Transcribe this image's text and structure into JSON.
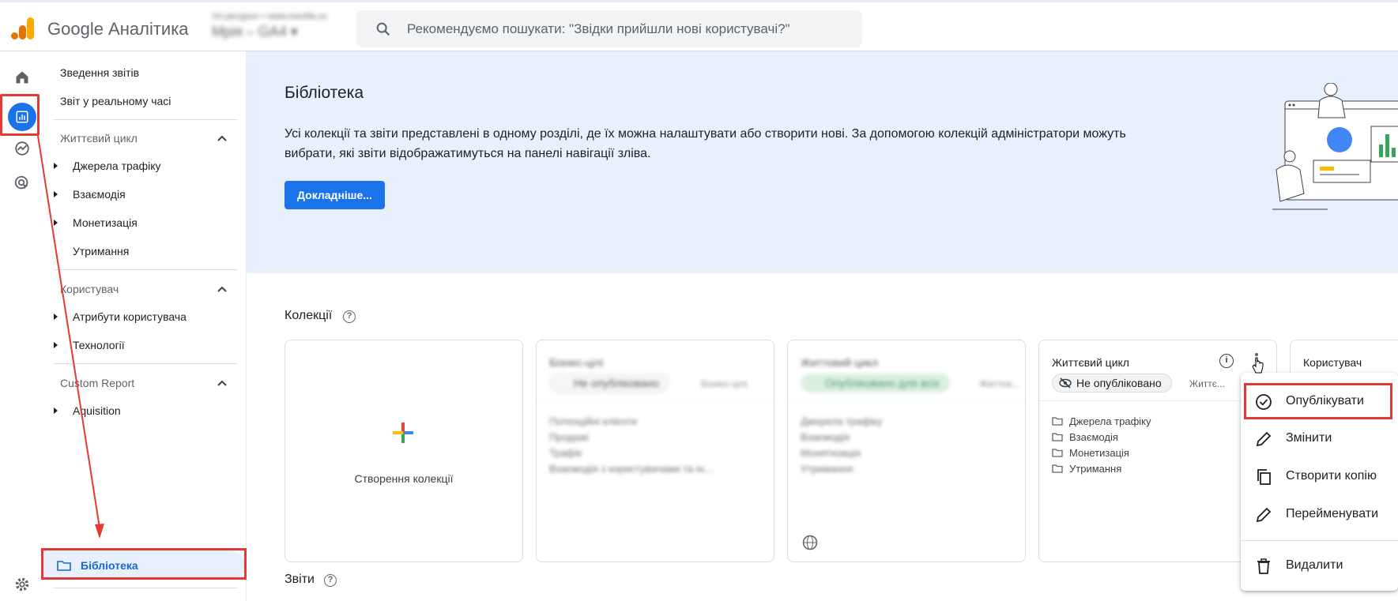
{
  "header": {
    "brand": "Google Аналітика",
    "account_line1": "Усі ресурси > www.mezilla.co",
    "account_line2": "Мрія – GA4 ▾",
    "search_placeholder": "Рекомендуємо пошукати: \"Звідки прийшли нові користувачі?\""
  },
  "rail": {
    "icons": [
      "home-icon",
      "reports-icon",
      "explore-icon",
      "advertising-icon",
      "settings-icon"
    ]
  },
  "nav": {
    "top_items": [
      "Зведення звітів",
      "Звіт у реальному часі"
    ],
    "sections": [
      {
        "title": "Життєвий цикл",
        "items": [
          "Джерела трафіку",
          "Взаємодія",
          "Монетизація",
          "Утримання"
        ]
      },
      {
        "title": "Користувач",
        "items": [
          "Атрибути користувача",
          "Технології"
        ]
      },
      {
        "title": "Custom Report",
        "items": [
          "Aquisition"
        ]
      }
    ],
    "library_label": "Бібліотека"
  },
  "hero": {
    "title": "Бібліотека",
    "description": "Усі колекції та звіти представлені в одному розділі, де їх можна налаштувати або створити нові. За допомогою колекцій адміністратори можуть вибрати, які звіти відображатимуться на панелі навігації зліва.",
    "button": "Докладніше..."
  },
  "collections_title": "Колекції",
  "reports_title": "Звіти",
  "cards": {
    "create_label": "Створення колекції",
    "c2": {
      "title": "Бізнес-цілі",
      "chip": "Не опубліковано",
      "crumb": "Бізнес-цілі",
      "rows": [
        "Потенційні клієнти",
        "Продажі",
        "Трафік",
        "Взаємодія з користувачами та ін..."
      ]
    },
    "c3": {
      "title": "Життєвий цикл",
      "chip": "Опубліковано для всіх",
      "crumb": "Життєв...",
      "rows": [
        "Джерела трафіку",
        "Взаємодія",
        "Монетизація",
        "Утримання"
      ]
    },
    "c4": {
      "title": "Життєвий цикл",
      "chip": "Не опубліковано",
      "crumb": "Життє...",
      "rows": [
        "Джерела трафіку",
        "Взаємодія",
        "Монетизація",
        "Утримання"
      ]
    },
    "c5": {
      "title": "Користувач"
    }
  },
  "menu": {
    "items": [
      "Опублікувати",
      "Змінити",
      "Створити копію",
      "Перейменувати",
      "Видалити"
    ]
  },
  "colors": {
    "accent": "#1a73e8",
    "highlight": "#e53935",
    "hero_bg": "#e8f0fe"
  }
}
